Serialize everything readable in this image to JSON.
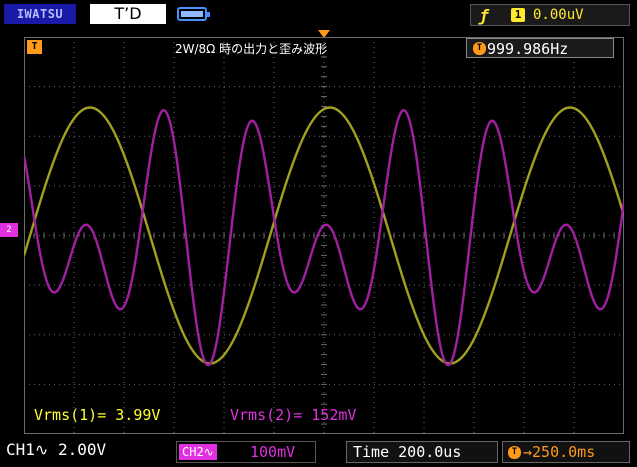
{
  "topbar": {
    "brand": "IWATSU",
    "status": "T’D",
    "trigger_channel": "1",
    "trigger_level": "0.00uV"
  },
  "plot": {
    "title": "2W/8Ω 時の出力と歪み波形",
    "trigger_marker": "T",
    "frequency": "999.986Hz",
    "ch2_marker": "2",
    "vrms1": "Vrms(1)= 3.99V",
    "vrms2": "Vrms(2)= 152mV"
  },
  "bottombar": {
    "ch1": "CH1∿  2.00V",
    "ch2_tag": "CH2∿",
    "ch2_scale": "100mV",
    "timebase": "Time 200.0us",
    "offset": "→250.0ms"
  },
  "colors": {
    "ch1": "#a0a020",
    "ch2": "#a020a0",
    "grid": "#6b6b6b",
    "accent": "#ff9a1a"
  },
  "waveforms": {
    "ch1": {
      "shape": "sine",
      "frequency_hz": 999.986,
      "time_per_div_us": 200,
      "rms_v": 3.99
    },
    "ch2": {
      "shape": "distortion (2nd/3rd harmonic)",
      "rms_mv": 152
    }
  }
}
